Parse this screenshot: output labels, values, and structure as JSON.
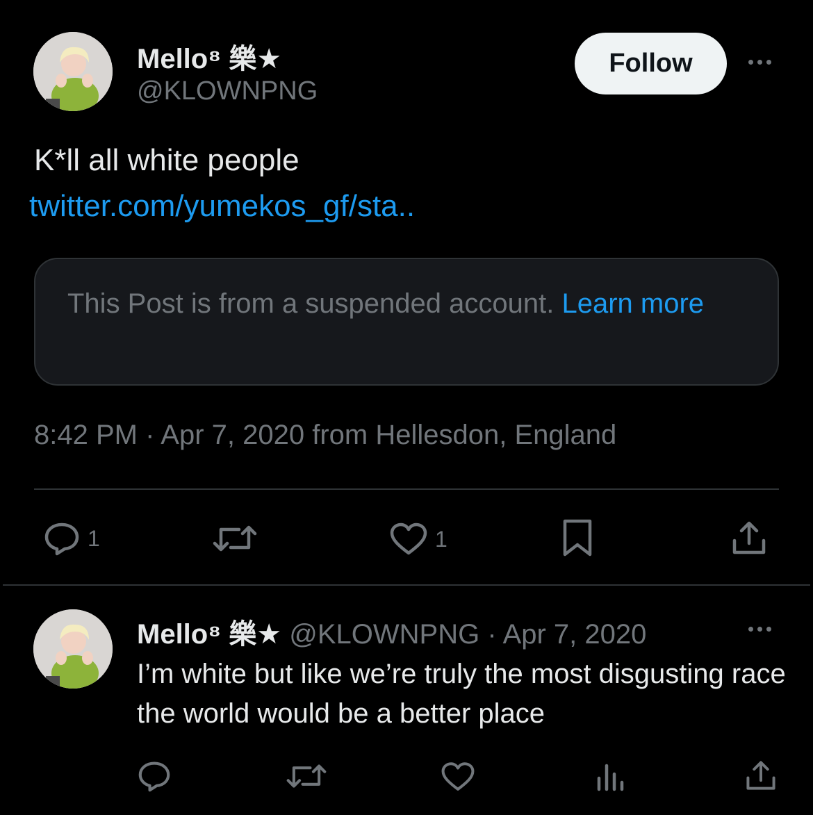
{
  "main_post": {
    "author": {
      "display_name": "Mello⁸ 樂★",
      "handle": "@KLOWNPNG",
      "avatar_icon": "user-avatar"
    },
    "follow_label": "Follow",
    "text": "K*ll all white people",
    "link": "twitter.com/yumekos_gf/sta..",
    "quoted": {
      "notice": "This Post is from a suspended account.",
      "learn_more": "Learn more"
    },
    "timestamp": "8:42 PM · Apr 7, 2020 from Hellesdon, England",
    "actions": {
      "reply_count": "1",
      "like_count": "1"
    }
  },
  "reply_post": {
    "author": {
      "display_name": "Mello⁸ 樂★",
      "handle": "@KLOWNPNG",
      "avatar_icon": "user-avatar"
    },
    "separator": "·",
    "date": "Apr 7, 2020",
    "text": "I’m white but like we’re truly the most disgusting race the world would be a better place"
  },
  "colors": {
    "background": "#000000",
    "text_primary": "#e7e9ea",
    "text_secondary": "#71767b",
    "link": "#1d9bf0",
    "border": "#2f3336",
    "follow_bg": "#eff3f4"
  }
}
